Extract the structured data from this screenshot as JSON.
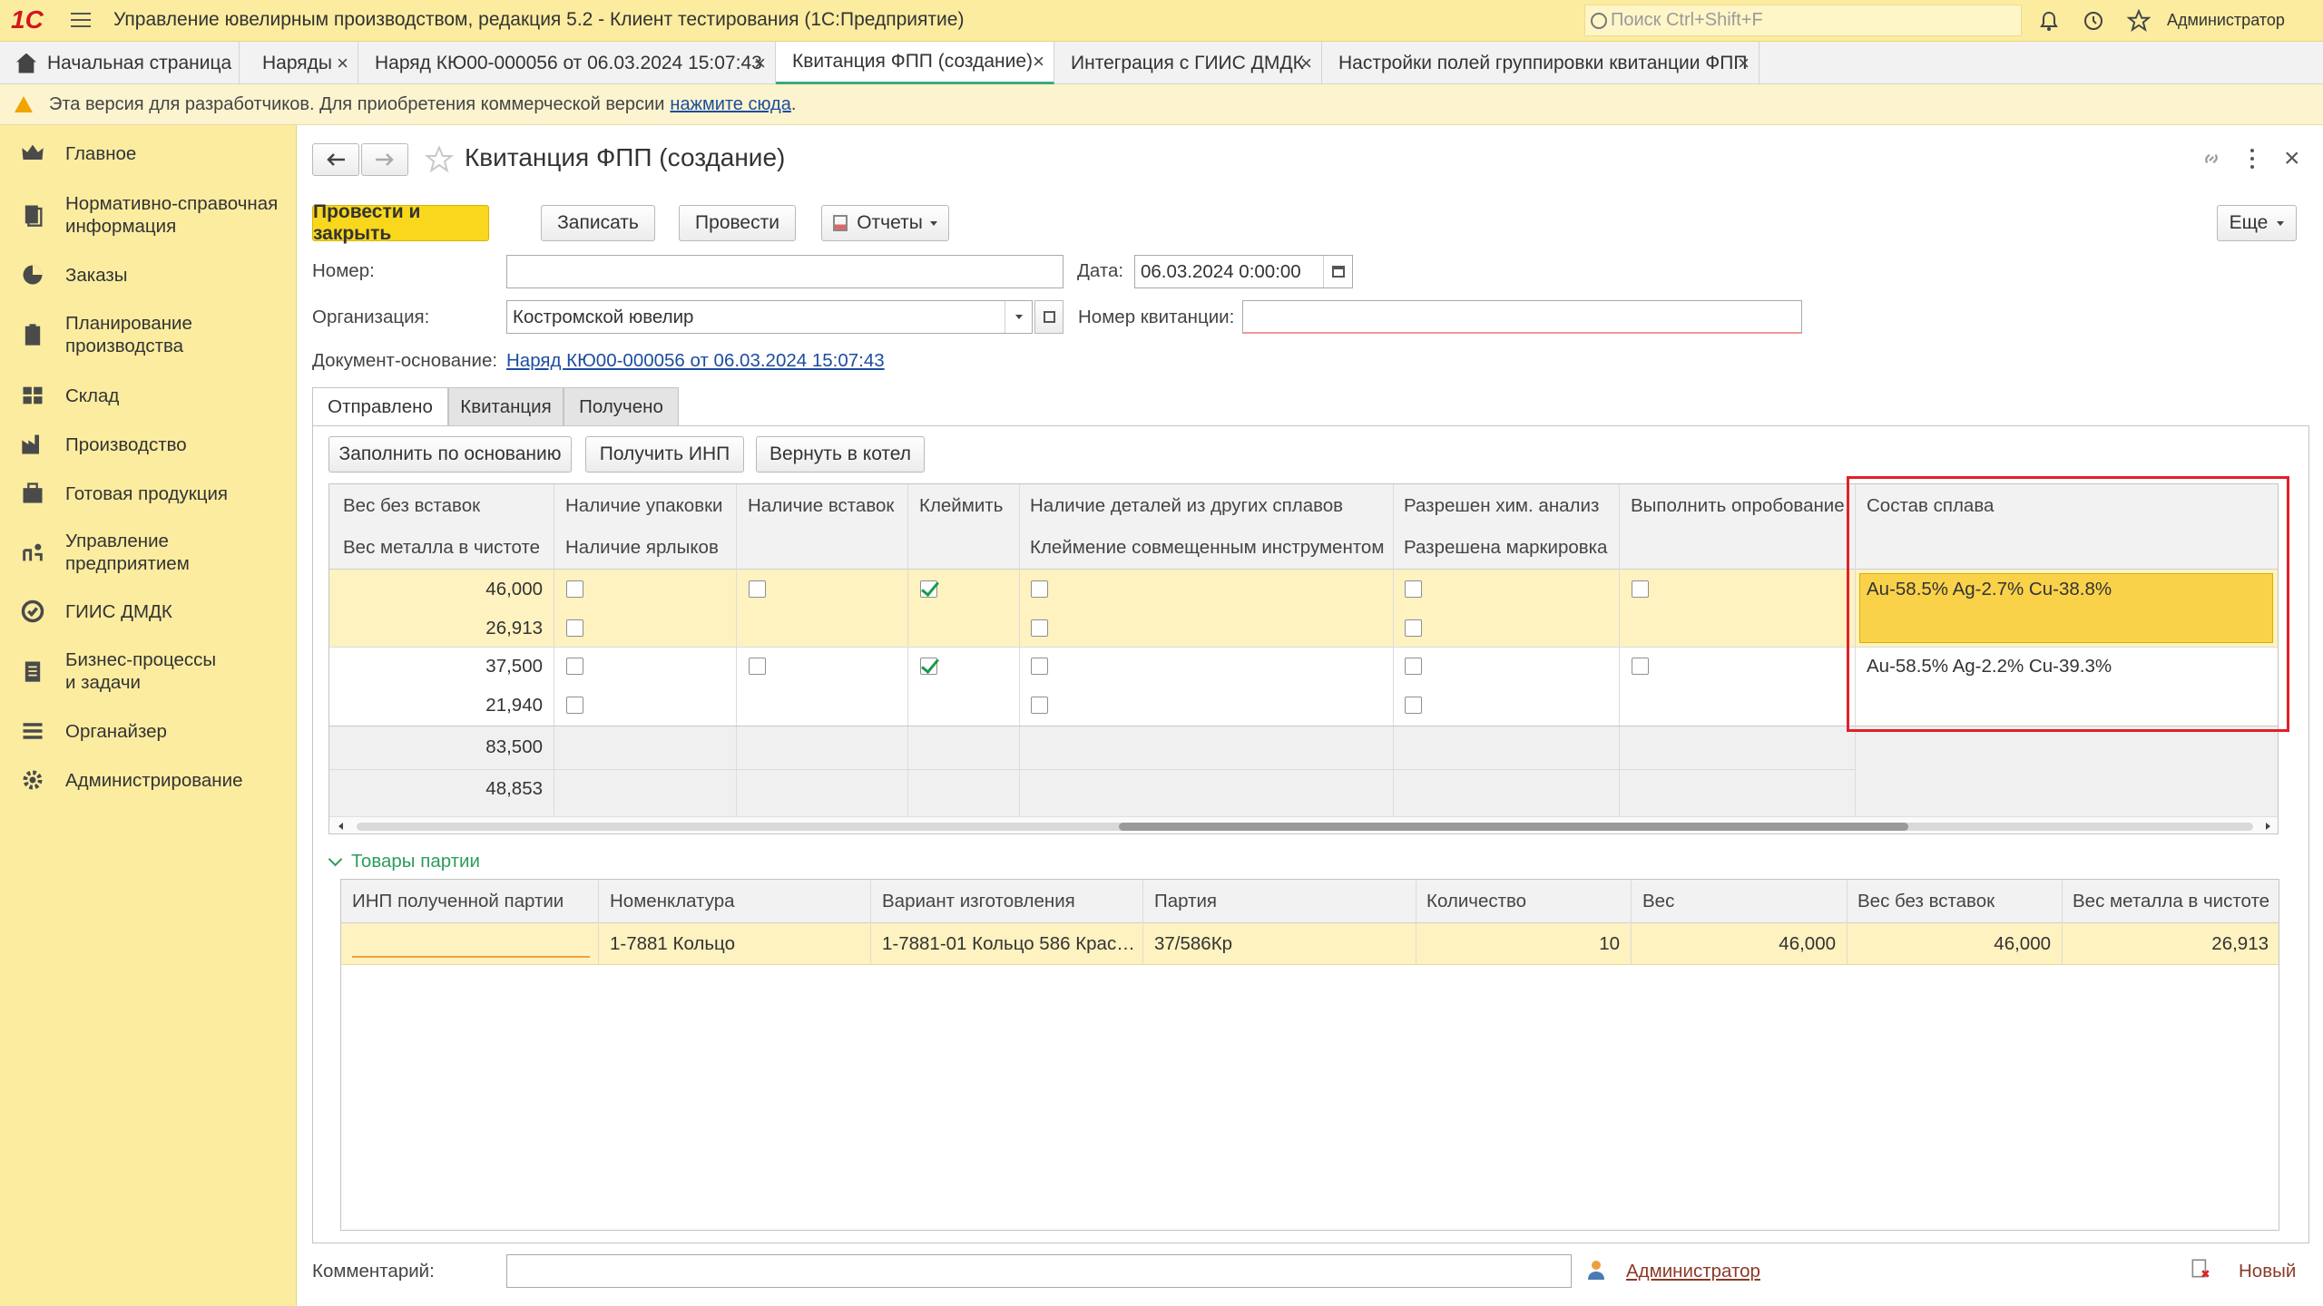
{
  "window": {
    "logo": "1С",
    "title": "Управление ювелирным производством, редакция 5.2  - Клиент тестирования (1С:Предприятие)",
    "search_placeholder": "Поиск Ctrl+Shift+F",
    "user": "Администратор"
  },
  "tabs": [
    {
      "label": "Начальная страница",
      "icon": "home-icon"
    },
    {
      "label": "Наряды"
    },
    {
      "label": "Наряд КЮ00-000056 от 06.03.2024 15:07:43"
    },
    {
      "label": "Квитанция ФПП (создание)",
      "active": true
    },
    {
      "label": "Интеграция с ГИИС ДМДК"
    },
    {
      "label": "Настройки полей группировки квитанции ФПП"
    }
  ],
  "devbar": {
    "text": "Эта версия для разработчиков. Для приобретения коммерческой версии",
    "link": "нажмите сюда",
    "tail": "."
  },
  "sidebar": {
    "items": [
      {
        "label": "Главное",
        "icon": "crown-icon"
      },
      {
        "label": "Нормативно-справочная\nинформация",
        "icon": "books-icon"
      },
      {
        "label": "Заказы",
        "icon": "pie-chart-icon"
      },
      {
        "label": "Планирование\nпроизводства",
        "icon": "clipboard-icon"
      },
      {
        "label": "Склад",
        "icon": "warehouse-icon"
      },
      {
        "label": "Производство",
        "icon": "factory-icon"
      },
      {
        "label": "Готовая продукция",
        "icon": "box-icon"
      },
      {
        "label": "Управление\nпредприятием",
        "icon": "management-icon"
      },
      {
        "label": "ГИИС ДМДК",
        "icon": "giis-icon"
      },
      {
        "label": "Бизнес-процессы\nи задачи",
        "icon": "tasks-icon"
      },
      {
        "label": "Органайзер",
        "icon": "organizer-icon"
      },
      {
        "label": "Администрирование",
        "icon": "gear-icon"
      }
    ]
  },
  "form": {
    "title": "Квитанция ФПП (создание)",
    "buttons": {
      "post_close": "Провести и закрыть",
      "save": "Записать",
      "post": "Провести",
      "reports": "Отчеты",
      "more": "Еще"
    },
    "number_label": "Номер:",
    "number_value": "",
    "date_label": "Дата:",
    "date_value": "06.03.2024  0:00:00",
    "org_label": "Организация:",
    "org_value": "Костромской ювелир",
    "receipt_label": "Номер квитанции:",
    "receipt_value": "",
    "basis_label": "Документ-основание:",
    "basis_value": "Наряд КЮ00-000056 от 06.03.2024 15:07:43",
    "subtabs": [
      "Отправлено",
      "Квитанция",
      "Получено"
    ],
    "actions": [
      "Заполнить по основанию",
      "Получить ИНП",
      "Вернуть в котел"
    ],
    "comment_label": "Комментарий:",
    "comment_value": "",
    "author": "Администратор",
    "status": "Новый"
  },
  "sent_table": {
    "headers": {
      "c1a": "Вес без вставок",
      "c1b": "Вес металла в чистоте",
      "c2a": "Наличие упаковки",
      "c2b": "Наличие ярлыков",
      "c3a": "Наличие вставок",
      "c4a": "Клеймить",
      "c5a": "Наличие деталей из других сплавов",
      "c5b": "Клеймение совмещенным инструментом",
      "c6a": "Разрешен хим. анализ",
      "c6b": "Разрешена маркировка",
      "c7a": "Выполнить опробование",
      "c8a": "Состав сплава"
    },
    "rows": [
      {
        "w1": "46,000",
        "w2": "26,913",
        "pack": false,
        "labels": false,
        "inserts": false,
        "stamp": true,
        "other_alloy": false,
        "combined": false,
        "chem": false,
        "marking": false,
        "assay": false,
        "alloy": "Au-58.5% Ag-2.7% Cu-38.8%"
      },
      {
        "w1": "37,500",
        "w2": "21,940",
        "pack": false,
        "labels": false,
        "inserts": false,
        "stamp": true,
        "other_alloy": false,
        "combined": false,
        "chem": false,
        "marking": false,
        "assay": false,
        "alloy": "Au-58.5% Ag-2.2% Cu-39.3%"
      }
    ],
    "totals": {
      "w1": "83,500",
      "w2": "48,853"
    }
  },
  "goods": {
    "group_label": "Товары партии",
    "headers": [
      "ИНП полученной партии",
      "Номенклатура",
      "Вариант изготовления",
      "Партия",
      "Количество",
      "Вес",
      "Вес без вставок",
      "Вес металла в чистоте"
    ],
    "rows": [
      [
        "",
        "1-7881 Кольцо",
        "1-7881-01 Кольцо 586 Крас…",
        "37/586Кр",
        "10",
        "46,000",
        "46,000",
        "26,913"
      ]
    ]
  },
  "colors": {
    "accent_yellow": "#fbeca0",
    "highlight_red": "#e0202a",
    "primary_button": "#f9d71c",
    "selected_row": "#f9d24a"
  }
}
